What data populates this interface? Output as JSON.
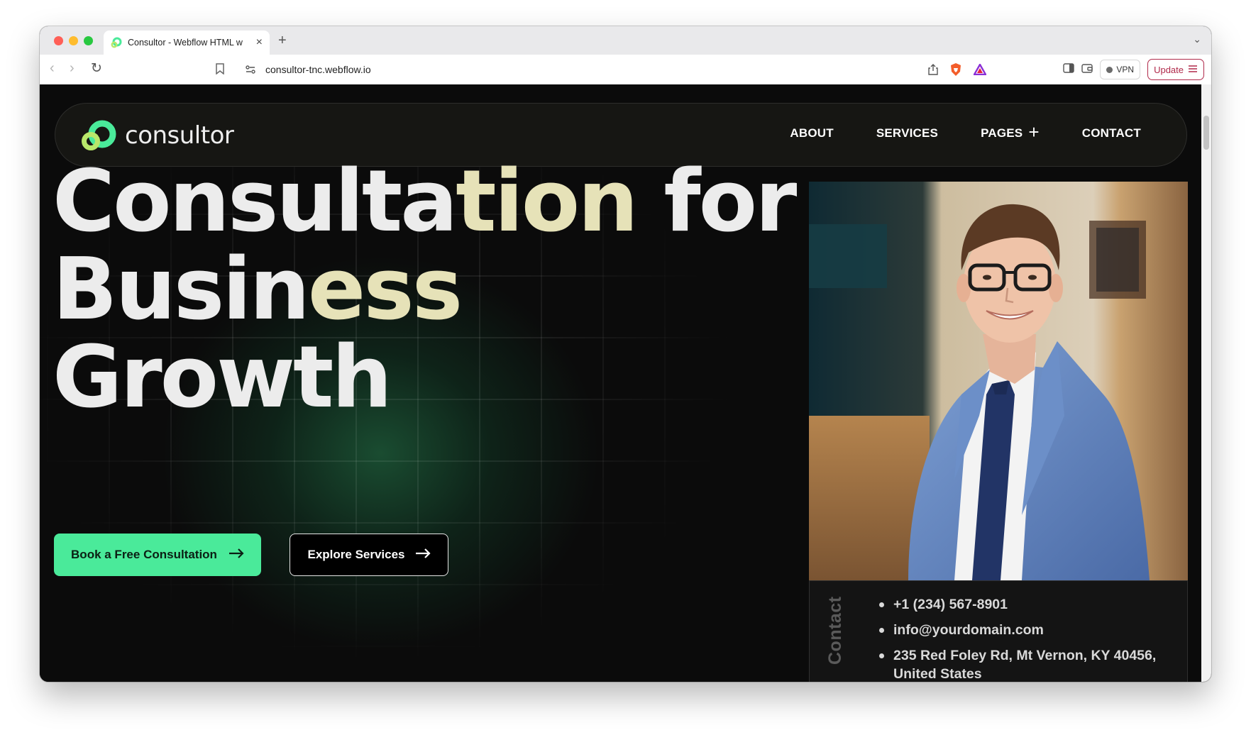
{
  "browser": {
    "tab_title": "Consultor - Webflow HTML w",
    "url": "consultor-tnc.webflow.io",
    "vpn_label": "VPN",
    "update_label": "Update"
  },
  "nav": {
    "brand": "consultor",
    "links": [
      "ABOUT",
      "SERVICES",
      "PAGES",
      "CONTACT"
    ]
  },
  "hero": {
    "line1_a": "Consulta",
    "line1_b": "tion",
    "line1_c": " for",
    "line2_a": "Busin",
    "line2_b": "ess",
    "line3": "Growth",
    "primary_cta": "Book a Free Consultation",
    "secondary_cta": "Explore Services"
  },
  "contact": {
    "label": "Contact",
    "items": [
      "+1 (234) 567-8901",
      "info@yourdomain.com",
      "235 Red Foley Rd, Mt Vernon, KY 40456, United States"
    ]
  },
  "colors": {
    "accent": "#4aea9a",
    "highlight_text": "#e6e2b8",
    "background": "#0b0b0b",
    "update_button": "#b0294a"
  }
}
